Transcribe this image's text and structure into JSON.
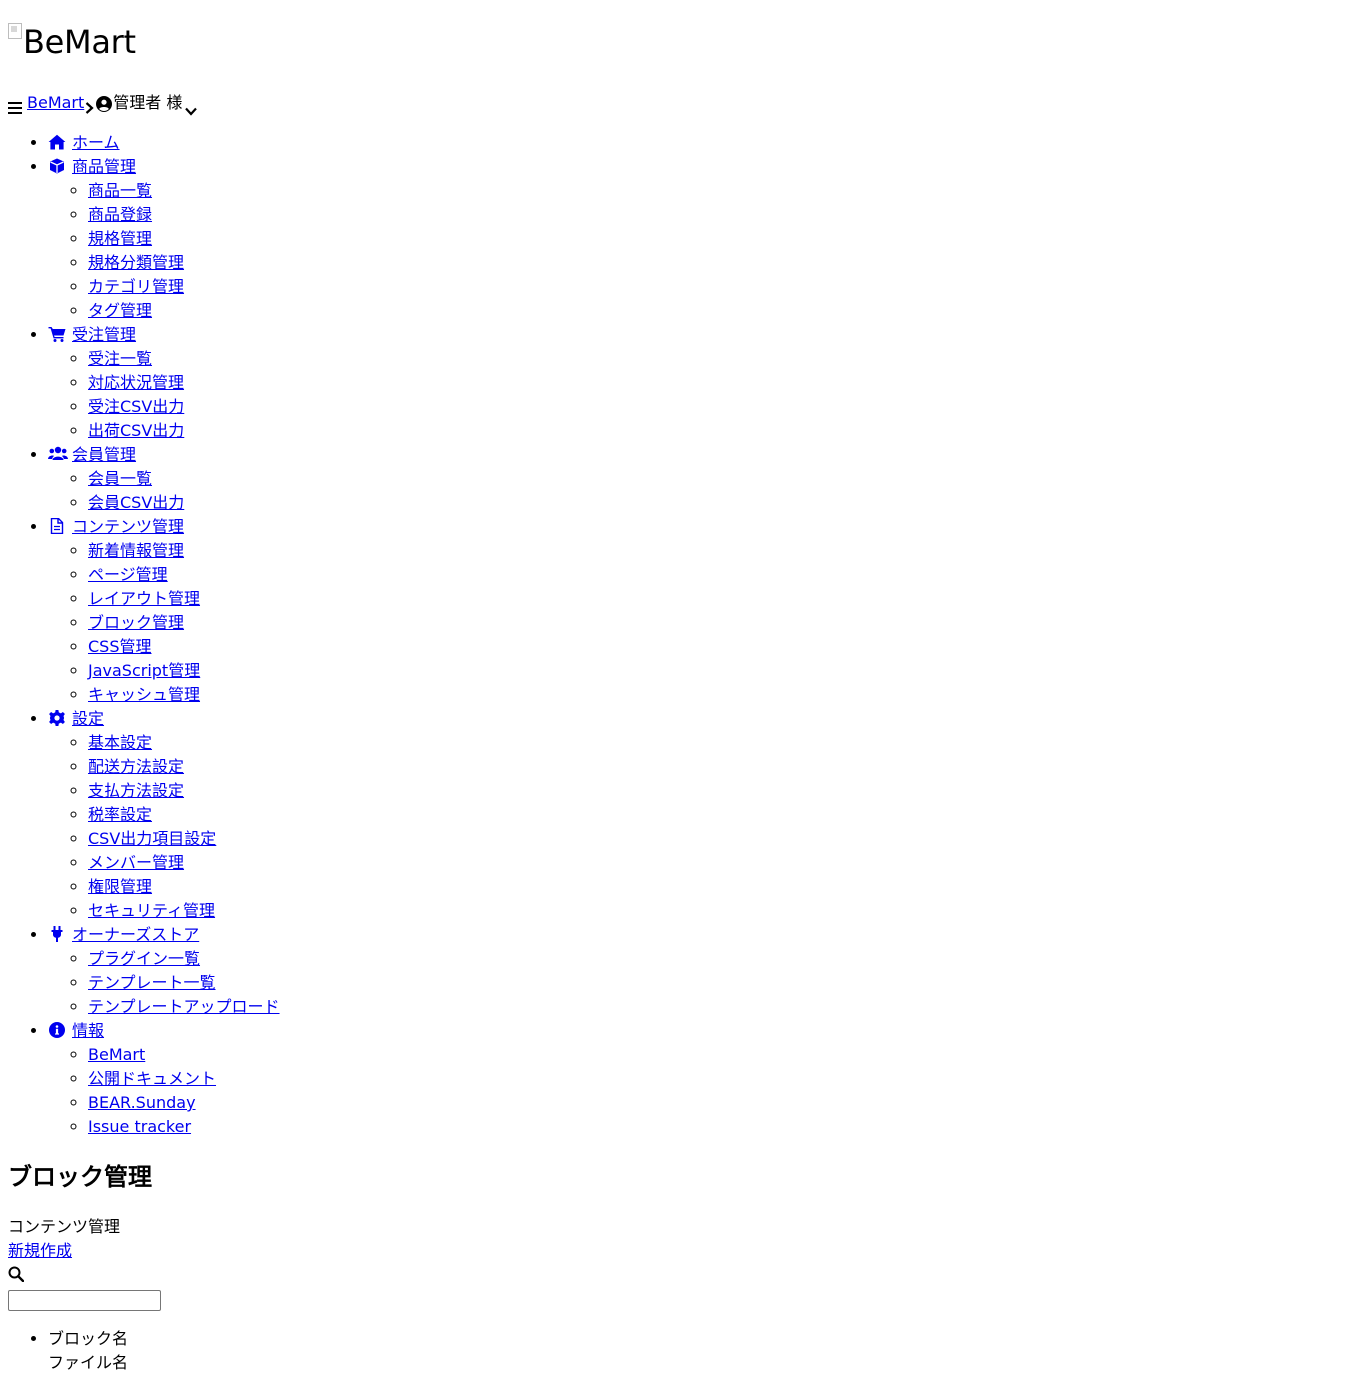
{
  "logo": {
    "alt": "BeMart"
  },
  "topbar": {
    "home_link": "BeMart",
    "user_label": "管理者 様"
  },
  "nav": [
    {
      "label": "ホーム",
      "icon": "home-icon",
      "children": []
    },
    {
      "label": "商品管理",
      "icon": "box-icon",
      "children": [
        "商品一覧",
        "商品登録",
        "規格管理",
        "規格分類管理",
        "カテゴリ管理",
        "タグ管理"
      ]
    },
    {
      "label": "受注管理",
      "icon": "cart-icon",
      "children": [
        "受注一覧",
        "対応状況管理",
        "受注CSV出力",
        "出荷CSV出力"
      ]
    },
    {
      "label": "会員管理",
      "icon": "users-icon",
      "children": [
        "会員一覧",
        "会員CSV出力"
      ]
    },
    {
      "label": "コンテンツ管理",
      "icon": "file-icon",
      "children": [
        "新着情報管理",
        "ページ管理",
        "レイアウト管理",
        "ブロック管理",
        "CSS管理",
        "JavaScript管理",
        "キャッシュ管理"
      ]
    },
    {
      "label": "設定",
      "icon": "gear-icon",
      "children": [
        "基本設定",
        "配送方法設定",
        "支払方法設定",
        "税率設定",
        "CSV出力項目設定",
        "メンバー管理",
        "権限管理",
        "セキュリティ管理"
      ]
    },
    {
      "label": "オーナーズストア",
      "icon": "plug-icon",
      "children": [
        "プラグイン一覧",
        "テンプレート一覧",
        "テンプレートアップロード"
      ]
    },
    {
      "label": "情報",
      "icon": "info-icon",
      "children": [
        "BeMart",
        "公開ドキュメント",
        "BEAR.Sunday",
        "Issue tracker"
      ]
    }
  ],
  "main": {
    "title": "ブロック管理",
    "section": "コンテンツ管理",
    "new_link": "新規作成",
    "search": {
      "value": "",
      "placeholder": ""
    },
    "columns": [
      "ブロック名",
      "ファイル名"
    ]
  },
  "colors": {
    "link": "#0000ee",
    "text": "#000000"
  }
}
